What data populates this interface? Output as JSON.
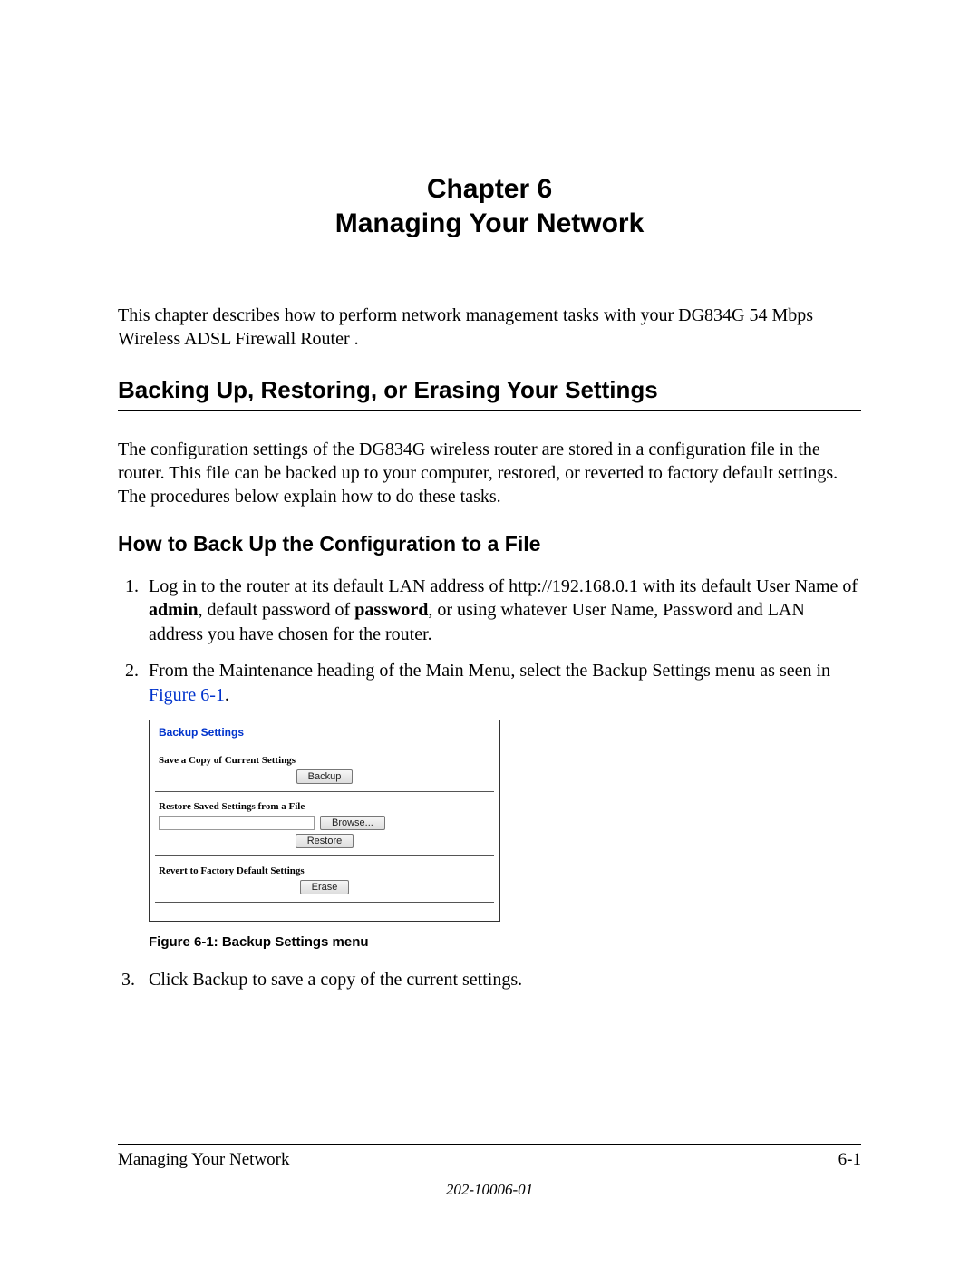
{
  "chapter": {
    "line1": "Chapter 6",
    "line2": "Managing Your Network"
  },
  "intro": "This chapter describes how to perform network management tasks with your DG834G 54 Mbps Wireless ADSL Firewall Router .",
  "section1": {
    "heading": "Backing Up, Restoring, or Erasing Your Settings",
    "para": "The configuration settings of the DG834G wireless router are stored in a configuration file in the router. This file can be backed up to your computer, restored, or reverted to factory default settings. The procedures below explain how to do these tasks."
  },
  "sub1": {
    "heading": "How to Back Up the Configuration to a File",
    "step1_a": "Log in to the router at its default LAN address of http://192.168.0.1 with its default User Name of ",
    "step1_admin": "admin",
    "step1_b": ", default password of ",
    "step1_password": "password",
    "step1_c": ", or using whatever User Name, Password and LAN address you have chosen for the router.",
    "step2_a": "From the Maintenance heading of the Main Menu, select the Backup Settings menu as seen in ",
    "step2_link": "Figure 6-1",
    "step2_b": ".",
    "step3_num": "3.",
    "step3": "Click Backup to save a copy of the current settings."
  },
  "figure": {
    "title": "Backup Settings",
    "save_label": "Save a Copy of Current Settings",
    "backup_btn": "Backup",
    "restore_label": "Restore Saved Settings from a File",
    "browse_btn": "Browse...",
    "restore_btn": "Restore",
    "revert_label": "Revert to Factory Default Settings",
    "erase_btn": "Erase",
    "caption": "Figure 6-1:  Backup Settings menu"
  },
  "footer": {
    "left": "Managing Your Network",
    "right": "6-1",
    "docnum": "202-10006-01"
  }
}
